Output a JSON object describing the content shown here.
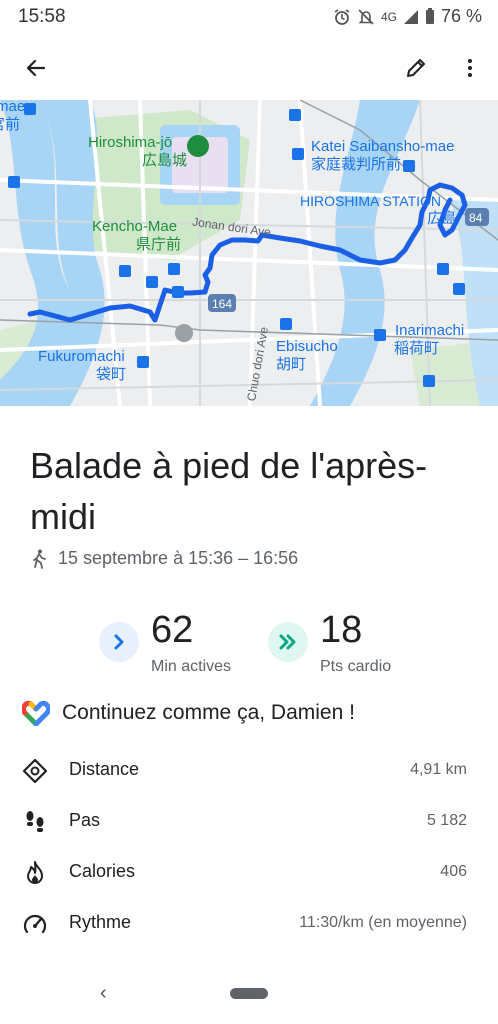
{
  "status_bar": {
    "time": "15:58",
    "network": "4G",
    "battery": "76 %"
  },
  "header": {
    "back_icon": "arrow-left-icon",
    "edit_icon": "pencil-icon",
    "more_icon": "more-vert-icon"
  },
  "map": {
    "labels": {
      "hiroshima_jo": "Hiroshima-jō",
      "hiroshima_jo_jp": "広島城",
      "katei": "Katei Saibansho-mae",
      "katei_jp": "家庭裁判所前",
      "station": "HIROSHIMA STATION",
      "station_jp": "広島",
      "kencho": "Kencho-Mae",
      "kencho_jp": "県庁前",
      "jonan": "Jonan dori Ave",
      "route": "164",
      "route84": "84",
      "inarimachi": "Inarimachi",
      "inarimachi_jp": "稲荷町",
      "ebisucho": "Ebisucho",
      "ebisucho_jp": "胡町",
      "fukuromachi": "Fukuromachi",
      "fukuromachi_jp": "袋町",
      "chuo": "Chuo dori Ave",
      "edge_top": "mae",
      "edge_top_jp": "宮前"
    },
    "colors": {
      "track": "#1a5fe6",
      "river": "#a8d4f5",
      "park": "#c9e6c2"
    }
  },
  "activity": {
    "title": "Balade à pied de l'après-midi",
    "date": "15 septembre à 15:36 – 16:56",
    "date_icon": "walking-icon"
  },
  "goals": [
    {
      "value": "62",
      "label": "Min actives",
      "icon": "chevron-right-icon",
      "color": "#1a73e8",
      "bg": "#e8f0fe"
    },
    {
      "value": "18",
      "label": "Pts cardio",
      "icon": "double-chevron-right-icon",
      "color": "#00a884",
      "bg": "#e0f6f0"
    }
  ],
  "encouragement": {
    "icon": "google-fit-heart-icon",
    "text": "Continuez comme ça, Damien !"
  },
  "stats": [
    {
      "icon": "distance-icon",
      "label": "Distance",
      "value": "4,91 km"
    },
    {
      "icon": "footsteps-icon",
      "label": "Pas",
      "value": "5 182"
    },
    {
      "icon": "flame-icon",
      "label": "Calories",
      "value": "406"
    },
    {
      "icon": "speedometer-icon",
      "label": "Rythme",
      "value": "11:30/km (en moyenne)"
    }
  ],
  "nav": {
    "back": "‹"
  }
}
